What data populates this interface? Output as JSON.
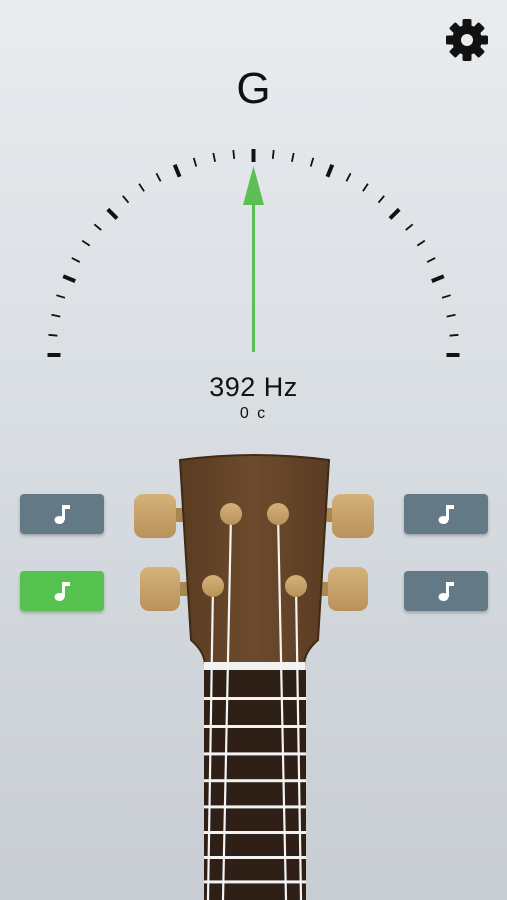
{
  "tuner": {
    "note": "G",
    "frequency": "392 Hz",
    "cents": "0 c",
    "needle_offset_cents": 0
  },
  "string_buttons": [
    {
      "id": "top-left",
      "icon": "music-note-icon",
      "active": false
    },
    {
      "id": "bottom-left",
      "icon": "music-note-icon",
      "active": true
    },
    {
      "id": "top-right",
      "icon": "music-note-icon",
      "active": false
    },
    {
      "id": "bottom-right",
      "icon": "music-note-icon",
      "active": false
    }
  ],
  "colors": {
    "needle": "#5cbf55",
    "active_button": "#55c24f",
    "inactive_button": "#637a86",
    "headstock": "#6b4a2e",
    "tuning_peg": "#c9a56e"
  }
}
